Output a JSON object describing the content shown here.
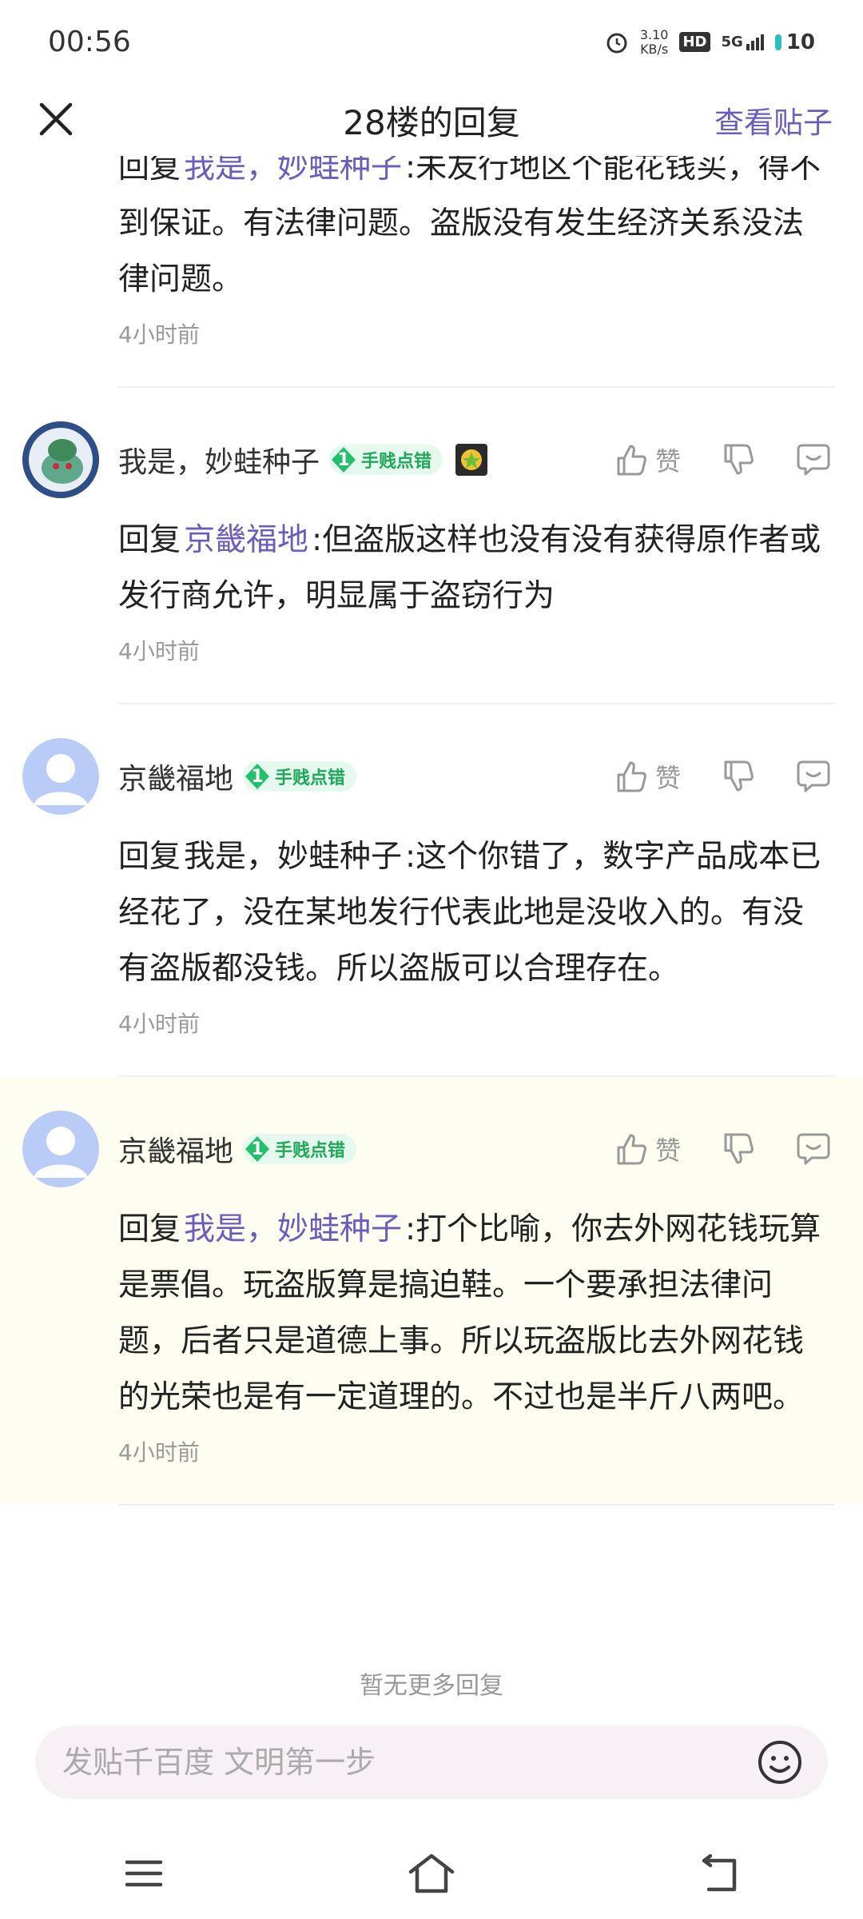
{
  "status_bar": {
    "time": "00:56",
    "net_speed_value": "3.10",
    "net_speed_unit": "KB/s",
    "hd": "HD",
    "network": "5G",
    "battery": "10"
  },
  "header": {
    "title": "28楼的回复",
    "view_post": "查看贴子"
  },
  "colors": {
    "accent": "#6d5bbd",
    "badge_green": "#1fa857",
    "highlight_bg": "#fdfdf1"
  },
  "replies": [
    {
      "partial": true,
      "reply_prefix": "回复",
      "mention": "我是，妙蛙种子",
      "text": ":未友行地区个能花钱买，得不到保证。有法律问题。盗版没有发生经济关系没法律问题。",
      "time": "4小时前"
    },
    {
      "user": "我是，妙蛙种子",
      "badge_level": "1",
      "badge_label": "手贱点错",
      "like_label": "赞",
      "reply_prefix": "回复",
      "mention": "京畿福地",
      "text": ":但盗版这样也没有没有获得原作者或发行商允许，明显属于盗窃行为",
      "time": "4小时前"
    },
    {
      "user": "京畿福地",
      "badge_level": "1",
      "badge_label": "手贱点错",
      "like_label": "赞",
      "reply_prefix": "回复",
      "mention": "我是，妙蛙种子",
      "text": ":这个你错了，数字产品成本已经花了，没在某地发行代表此地是没收入的。有没有盗版都没钱。所以盗版可以合理存在。",
      "time": "4小时前"
    },
    {
      "user": "京畿福地",
      "badge_level": "1",
      "badge_label": "手贱点错",
      "like_label": "赞",
      "reply_prefix": "回复",
      "mention": "我是，妙蛙种子",
      "text": ":打个比喻，你去外网花钱玩算是票倡。玩盗版算是搞迫鞋。一个要承担法律问题，后者只是道德上事。所以玩盗版比去外网花钱的光荣也是有一定道理的。不过也是半斤八两吧。",
      "time": "4小时前"
    }
  ],
  "footer": {
    "no_more": "暂无更多回复",
    "input_placeholder": "发贴千百度 文明第一步"
  }
}
